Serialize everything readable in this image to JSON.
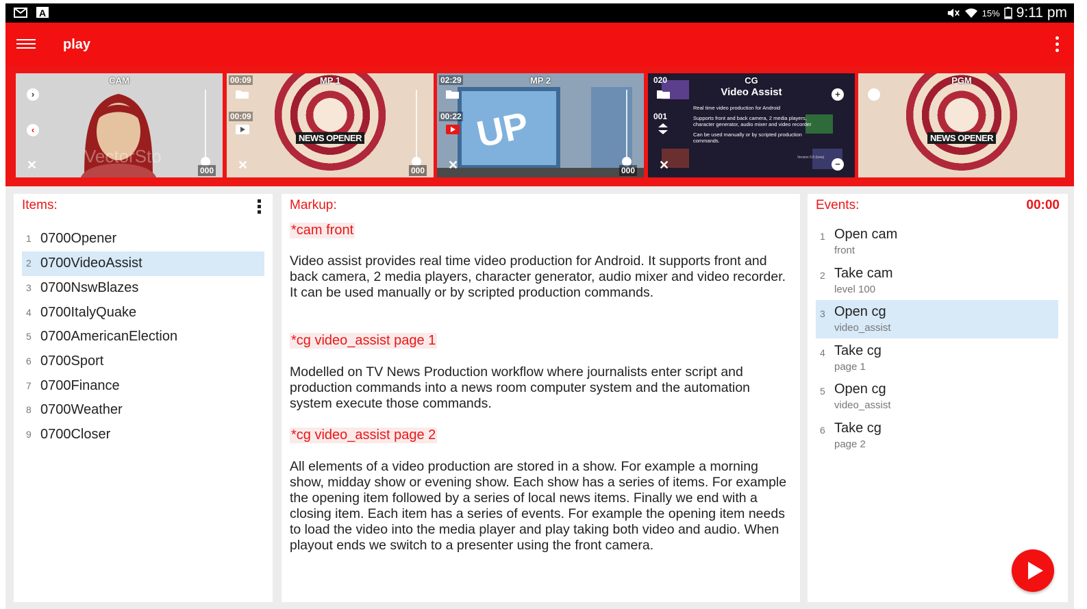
{
  "statusbar": {
    "battery": "15%",
    "time": "9:11 pm"
  },
  "appbar": {
    "title": "play"
  },
  "thumbnails": {
    "cam": {
      "label": "CAM",
      "counter": "000"
    },
    "mp1": {
      "label": "MP 1",
      "time_top": "00:09",
      "time_bottom": "00:09",
      "overlay": "NEWS OPENER",
      "counter": "000"
    },
    "mp2": {
      "label": "MP 2",
      "time_top": "02:29",
      "time_bottom": "00:22",
      "counter": "000"
    },
    "cg": {
      "label": "CG",
      "num_top": "020",
      "num_bottom": "001",
      "overlay_title": "Video Assist",
      "bullets": [
        "Real time video production for Android",
        "Supports front and back camera, 2 media players, character generator, audio mixer and video recorder",
        "Can be used manually or by scripted production commands."
      ],
      "version": "Version 0.8 (beta)"
    },
    "pgm": {
      "label": "PGM",
      "overlay": "NEWS OPENER"
    }
  },
  "items_panel": {
    "title": "Items:",
    "items": [
      {
        "num": "1",
        "name": "0700Opener"
      },
      {
        "num": "2",
        "name": "0700VideoAssist"
      },
      {
        "num": "3",
        "name": "0700NswBlazes"
      },
      {
        "num": "4",
        "name": "0700ItalyQuake"
      },
      {
        "num": "5",
        "name": "0700AmericanElection"
      },
      {
        "num": "6",
        "name": "0700Sport"
      },
      {
        "num": "7",
        "name": "0700Finance"
      },
      {
        "num": "8",
        "name": "0700Weather"
      },
      {
        "num": "9",
        "name": "0700Closer"
      }
    ]
  },
  "markup_panel": {
    "title": "Markup:",
    "cmd1": "*cam front",
    "para1": "Video assist provides real time video production for Android. It supports front and back camera, 2 media players, character generator, audio mixer and video recorder. It can be used manually or by scripted production commands.",
    "cmd2": "*cg video_assist page 1",
    "para2": "Modelled on TV News Production workflow where journalists enter script and production commands into a news room computer system and the automation system execute those commands.",
    "cmd3": "*cg video_assist page 2",
    "para3": "All elements of a video production are stored in a  show. For example a morning show, midday show or evening show. Each show has a series of items. For example the opening item followed by a series of local news items. Finally we end with a closing item. Each item has a series of events. For example the opening item needs to load the video into the media player and play taking both video and audio. When playout ends we switch to a presenter using the front camera."
  },
  "events_panel": {
    "title": "Events:",
    "clock": "00:00",
    "events": [
      {
        "num": "1",
        "action": "Open cam",
        "detail": "front"
      },
      {
        "num": "2",
        "action": "Take cam",
        "detail": "level 100"
      },
      {
        "num": "3",
        "action": "Open cg",
        "detail": "video_assist"
      },
      {
        "num": "4",
        "action": "Take cg",
        "detail": "page 1"
      },
      {
        "num": "5",
        "action": "Open cg",
        "detail": "video_assist"
      },
      {
        "num": "6",
        "action": "Take cg",
        "detail": "page 2"
      }
    ]
  },
  "colors": {
    "accent": "#f21010",
    "selection": "#d8e9f7"
  }
}
